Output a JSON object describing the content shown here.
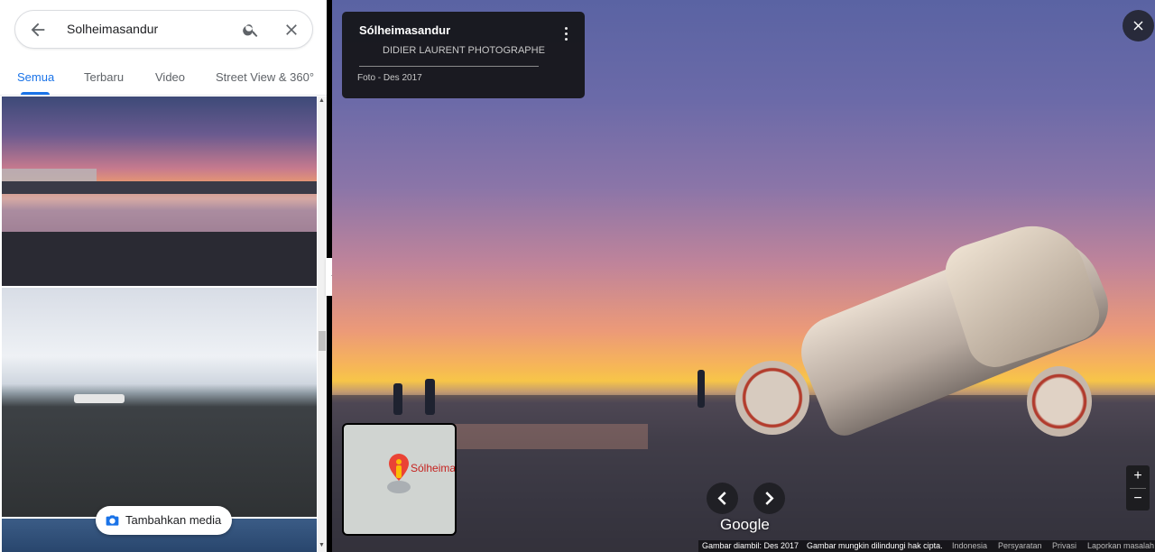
{
  "search": {
    "query": "Solheimasandur"
  },
  "tabs": [
    {
      "label": "Semua",
      "active": true
    },
    {
      "label": "Terbaru",
      "active": false
    },
    {
      "label": "Video",
      "active": false
    },
    {
      "label": "Street View & 360°",
      "active": false
    }
  ],
  "add_media_label": "Tambahkan media",
  "info": {
    "title": "Sólheimasandur",
    "photographer": "DIDIER LAURENT PHOTOGRAPHE",
    "date": "Foto - Des 2017"
  },
  "minimap": {
    "label": "Sólheima"
  },
  "google_logo": "Google",
  "zoom": {
    "in": "+",
    "out": "−"
  },
  "footer": {
    "captured": "Gambar diambil: Des 2017",
    "copyright": "Gambar mungkin dilindungi hak cipta.",
    "region": "Indonesia",
    "terms": "Persyaratan",
    "privacy": "Privasi",
    "report": "Laporkan masalah"
  },
  "colors": {
    "accent": "#1a73e8",
    "pin": "#ea4335"
  },
  "icons": [
    "back-arrow-icon",
    "search-icon",
    "clear-icon",
    "camera-icon",
    "chevron-left-icon",
    "chevron-right-icon",
    "close-icon",
    "more-vert-icon",
    "pegman-icon"
  ]
}
